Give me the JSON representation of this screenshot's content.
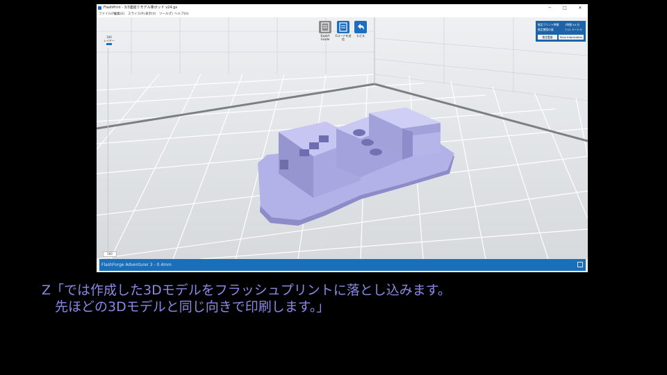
{
  "window": {
    "title": "FlashPrint - 3/3連結ミモデル車ボッド v24.gx",
    "controls": {
      "minimize": "─",
      "maximize": "□",
      "close": "✕"
    }
  },
  "menu": [
    "ファイル(F)",
    "編集(E)",
    "スライス(P)",
    "表示(V)",
    "ツール(T)",
    "ヘルプ(H)"
  ],
  "toolbar": {
    "export_label_1": "Export",
    "export_label_2": "Gcode",
    "gcode_label_1": "Gコードを送",
    "gcode_label_2": "信",
    "back_label": "もどる"
  },
  "info": {
    "time_label": "推定プリント時間",
    "time_value": "1時間 44 分",
    "filament_label": "推定樹脂の量",
    "filament_value": "7.11 メートル",
    "estimate_button": "推定重量",
    "slice_info_button": "Slice Information"
  },
  "layer": {
    "label_top": "160",
    "label_name": "レイヤー",
    "label_bottom": "160"
  },
  "status": {
    "printer": "FlashForge Adventurer 3 - 0.4mm"
  },
  "colors": {
    "statusbar": "#1a6fba",
    "model": "#a9a8e2",
    "subtitle": "#8a8ae6"
  },
  "subtitle": {
    "line1": "Z「では作成した3Dモデルをフラッシュプリントに落とし込みます。",
    "line2": "　先ほどの3Dモデルと同じ向きで印刷します。」"
  }
}
